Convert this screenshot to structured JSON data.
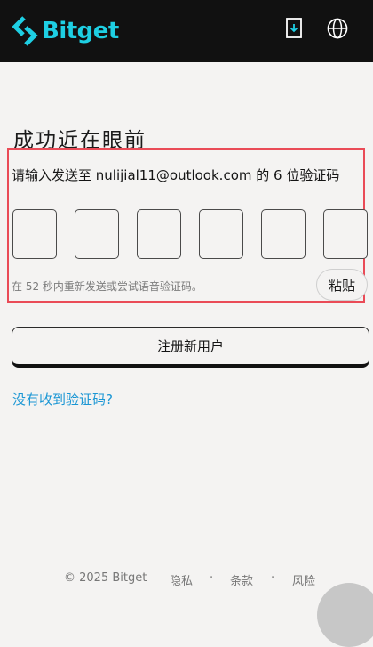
{
  "header": {
    "brand": "Bitget",
    "brand_color": "#1ecfe3",
    "icons": [
      "download-icon",
      "globe-icon"
    ]
  },
  "verification": {
    "title": "成功近在眼前",
    "instruction": "请输入发送至 nulijial11@outlook.com 的 6 位验证码",
    "code_digits": [
      "",
      "",
      "",
      "",
      "",
      ""
    ],
    "resend_hint": "在 52 秒内重新发送或尝试语音验证码。",
    "paste_label": "粘贴"
  },
  "register_label": "注册新用户",
  "no_code_link": "没有收到验证码?",
  "footer": {
    "copyright": "© 2025 Bitget",
    "privacy": "隐私",
    "terms": "条款",
    "risk": "风险",
    "separator": "·"
  },
  "colors": {
    "highlight": "#ea4b57",
    "link": "#1a96d4",
    "header_bg": "#111111",
    "page_bg": "#f4f3f2"
  }
}
